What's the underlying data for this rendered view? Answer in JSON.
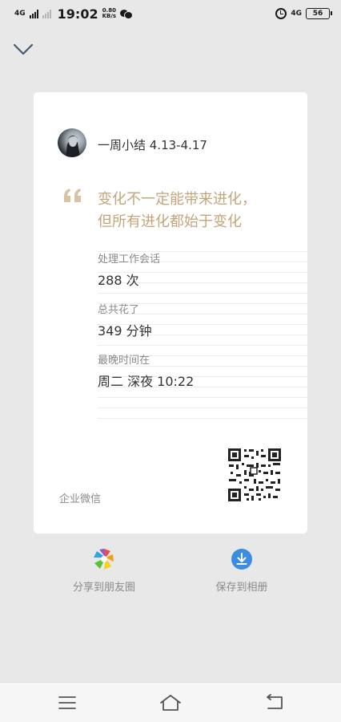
{
  "status_bar": {
    "network_left": "4G",
    "time": "19:02",
    "speed_value": "0.80",
    "speed_unit": "KB/s",
    "network_right": "4G",
    "battery": "56"
  },
  "icons": {
    "collapse": "chevron-down-icon",
    "share": "moments-aperture-icon",
    "save": "download-icon",
    "nav_menu": "menu-icon",
    "nav_home": "home-icon",
    "nav_back": "back-icon"
  },
  "card": {
    "title": "一周小结 4.13-4.17",
    "quote_line1": "变化不一定能带来进化，",
    "quote_line2": "但所有进化都始于变化",
    "stats": [
      {
        "label": "处理工作会话",
        "value": "288 次"
      },
      {
        "label": "总共花了",
        "value": "349 分钟"
      },
      {
        "label": "最晚时间在",
        "value": "周二 深夜 10:22"
      }
    ],
    "brand": "企业微信"
  },
  "actions": {
    "share_label": "分享到朋友圈",
    "save_label": "保存到相册"
  },
  "colors": {
    "background": "#e8e8e8",
    "card": "#ffffff",
    "quote_accent": "#c4a57a",
    "save_icon": "#3b8de0"
  }
}
